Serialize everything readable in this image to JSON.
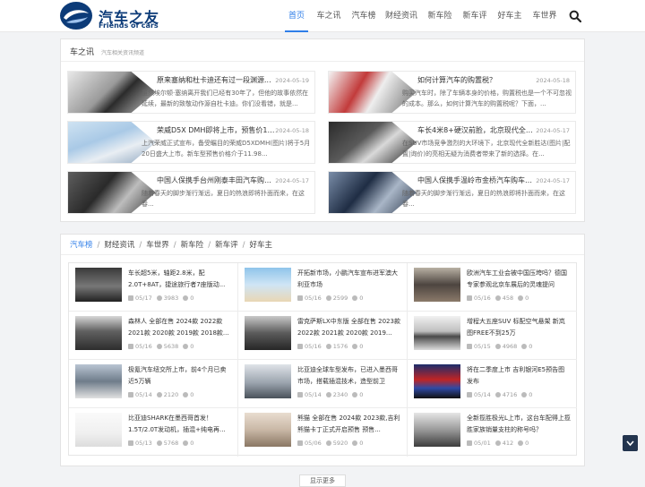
{
  "header": {
    "brand_cn": "汽车之友",
    "brand_en": "Friends of cars",
    "nav": [
      "首页",
      "车之讯",
      "汽车榜",
      "财经资讯",
      "新车险",
      "新车评",
      "好车主",
      "车世界"
    ],
    "active_nav": "首页",
    "accent": "#2f7ee8"
  },
  "news": {
    "title": "车之讯",
    "subtitle": "汽车相关资讯频道",
    "cards": [
      {
        "title": "原来塞纳和杜卡迪还有过一段渊源...",
        "date": "2024-05-19",
        "desc": "虽然埃尔顿·塞纳离开我们已经有30年了，但他的故事依然在延续，最新的致敬动作源自杜卡迪。你们没看错，就是..."
      },
      {
        "title": "如何计算汽车的购置税？",
        "date": "2024-05-18",
        "desc": "购买汽车时，除了车辆本身的价格，购置税也是一个不可忽视的成本。那么，如何计算汽车的购置税呢？下面，..."
      },
      {
        "title": "荣威D5X DMH即将上市，预售价11....",
        "date": "2024-05-18",
        "desc": "上汽荣威正式宣布，备受瞩目的荣威D5XDMH(图片)将于5月20日盛大上市。新车型预售价格介于11.98..."
      },
      {
        "title": "车长4米8+硬汉前脸，北京现代全新...",
        "date": "2024-05-17",
        "desc": "在SUV市场竞争激烈的大环境下，北京现代全新胜达(图片|配置|询价)的亮相无疑为消费者带来了新的选择。在..."
      },
      {
        "title": "中国人保携手台州刚泰丰田汽车购车...",
        "date": "2024-05-17",
        "desc": "随着春天的脚步渐行渐远，夏日的热浪即将扑面而来，在这春..."
      },
      {
        "title": "中国人保携手温岭市金桥汽车购车嘉...",
        "date": "2024-05-17",
        "desc": "随着春天的脚步渐行渐远，夏日的热浪即将扑面而来，在这春..."
      }
    ]
  },
  "ranking": {
    "tabs": [
      "汽车榜",
      "财经资讯",
      "车世界",
      "新车险",
      "新车评",
      "好车主"
    ],
    "active_tab": "汽车榜",
    "items": [
      {
        "title": "车长超5米，轴距2.8米，配2.0T+8AT，捷途旅行者7座版动...",
        "date": "05/17",
        "views": "3983",
        "comments": "0"
      },
      {
        "title": "开拓新市场，小鹏汽车宣布进军澳大利亚市场",
        "date": "05/16",
        "views": "2599",
        "comments": "0"
      },
      {
        "title": "欧洲汽车工业会被中国压垮吗？德国专家参观北京车展后的灵魂提问",
        "date": "05/16",
        "views": "458",
        "comments": "0"
      },
      {
        "title": "森林人 全部在售 2024款 2022款 2021款 2020款 2019款 2018款...",
        "date": "05/16",
        "views": "5638",
        "comments": "0"
      },
      {
        "title": "雷克萨斯LX中东版 全部在售 2023款 2022款 2021款 2020款 2019...",
        "date": "05/16",
        "views": "1576",
        "comments": "0"
      },
      {
        "title": "增程大五座SUV 标配空气悬架 新岚图FREE不到25万",
        "date": "05/15",
        "views": "4968",
        "comments": "0"
      },
      {
        "title": "极氪汽车纽交所上市，前4个月已卖近5万辆",
        "date": "05/14",
        "views": "2120",
        "comments": "0"
      },
      {
        "title": "比亚迪全球车型发布，已进入墨西哥市场，搭载插混技术，造型前卫",
        "date": "05/14",
        "views": "2340",
        "comments": "0"
      },
      {
        "title": "将在二季度上市 吉利银河E5预告图发布",
        "date": "05/14",
        "views": "4716",
        "comments": "0"
      },
      {
        "title": "比亚迪SHARK在墨西哥首发！1.5T/2.0T发动机，插混+纯电再...",
        "date": "05/13",
        "views": "5768",
        "comments": "0"
      },
      {
        "title": "熊猫 全部在售 2024款 2023款,吉利熊猫卡丁正式开启预售 预售...",
        "date": "05/06",
        "views": "5920",
        "comments": "0"
      },
      {
        "title": "全新揽胜极光L上市，这台车配得上揽胜家族销量支柱的称号吗？",
        "date": "05/01",
        "views": "412",
        "comments": "0"
      }
    ]
  },
  "more_label": "显示更多"
}
